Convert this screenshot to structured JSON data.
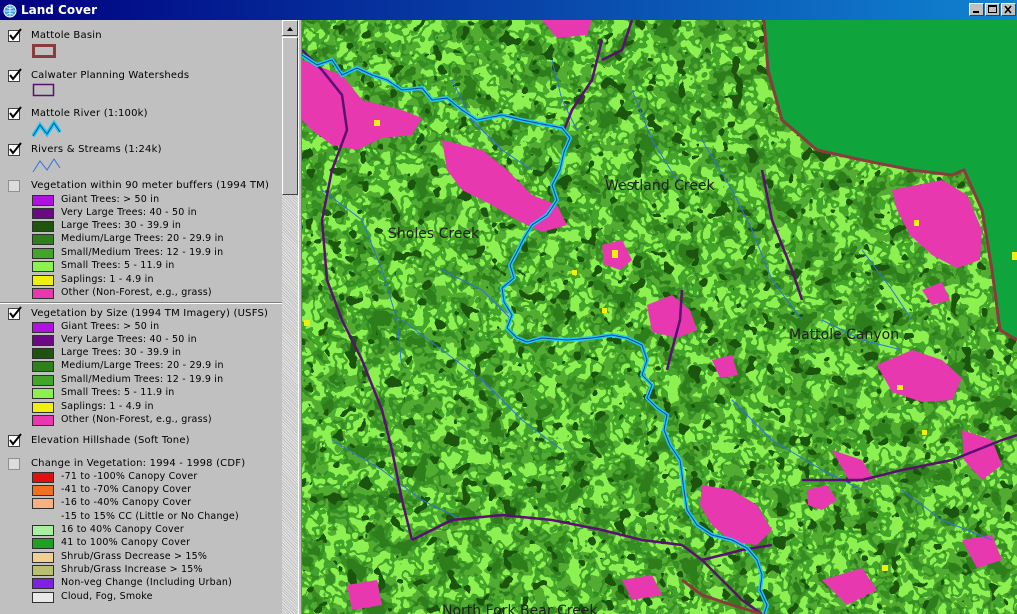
{
  "window": {
    "title": "Land Cover",
    "icon": "globe-icon",
    "controls": [
      "minimize-icon",
      "maximize-icon",
      "close-icon"
    ]
  },
  "toc": {
    "layers": [
      {
        "name": "Mattole Basin",
        "checked": true
      },
      {
        "name": "Calwater Planning Watersheds",
        "checked": true
      },
      {
        "name": "Mattole River (1:100k)",
        "checked": true
      },
      {
        "name": "Rivers & Streams (1:24k)",
        "checked": true
      },
      {
        "name": "Vegetation within 90 meter buffers (1994 TM)",
        "checked": false,
        "classes": [
          {
            "label": "Giant Trees: > 50 in",
            "color": "#b010e0"
          },
          {
            "label": "Very Large Trees: 40 - 50 in",
            "color": "#6a0a82"
          },
          {
            "label": "Large Trees: 30 - 39.9 in",
            "color": "#1f5410"
          },
          {
            "label": "Medium/Large Trees: 20 - 29.9 in",
            "color": "#2f7f1d"
          },
          {
            "label": "Small/Medium Trees: 12 - 19.9 in",
            "color": "#43a42a"
          },
          {
            "label": "Small Trees: 5 - 11.9 in",
            "color": "#8cf050"
          },
          {
            "label": "Saplings: 1 - 4.9 in",
            "color": "#f0f010"
          },
          {
            "label": "Other (Non-Forest, e.g., grass)",
            "color": "#e838b0"
          }
        ]
      },
      {
        "name": "Vegetation by Size (1994 TM Imagery) (USFS)",
        "checked": true,
        "classes": [
          {
            "label": "Giant Trees: > 50 in",
            "color": "#b010e0"
          },
          {
            "label": "Very Large Trees: 40 - 50 in",
            "color": "#6a0a82"
          },
          {
            "label": "Large Trees: 30 - 39.9 in",
            "color": "#1f5410"
          },
          {
            "label": "Medium/Large Trees: 20 - 29.9 in",
            "color": "#2f7f1d"
          },
          {
            "label": "Small/Medium Trees: 12 - 19.9 in",
            "color": "#43a42a"
          },
          {
            "label": "Small Trees: 5 - 11.9 in",
            "color": "#8cf050"
          },
          {
            "label": "Saplings: 1 - 4.9 in",
            "color": "#f0f010"
          },
          {
            "label": "Other (Non-Forest, e.g., grass)",
            "color": "#e838b0"
          }
        ]
      },
      {
        "name": "Elevation Hillshade (Soft Tone)",
        "checked": true
      },
      {
        "name": "Change in Vegetation: 1994 - 1998 (CDF)",
        "checked": false,
        "classes": [
          {
            "label": "-71 to -100% Canopy Cover",
            "color": "#e01010"
          },
          {
            "label": "-41 to -70% Canopy Cover",
            "color": "#f07020"
          },
          {
            "label": "-16 to -40% Canopy Cover",
            "color": "#f8b080"
          },
          {
            "label": "-15 to 15% CC (Little or No Change)",
            "color": "none"
          },
          {
            "label": "16 to 40% Canopy Cover",
            "color": "#a8f0a0"
          },
          {
            "label": "41 to 100% Canopy Cover",
            "color": "#20a020"
          },
          {
            "label": "Shrub/Grass Decrease > 15%",
            "color": "#f0d090"
          },
          {
            "label": "Shrub/Grass Increase > 15%",
            "color": "#b8c070"
          },
          {
            "label": "Non-veg Change (Including Urban)",
            "color": "#8020e0"
          },
          {
            "label": "Cloud, Fog, Smoke",
            "color": "#e8e8e8"
          }
        ]
      }
    ]
  },
  "map": {
    "labels": [
      "Westland Creek",
      "Sholes Creek",
      "Mattole Canyon",
      "North Fork Bear Creek"
    ],
    "colors": {
      "small_trees": "#8cf050",
      "small_medium": "#43a42a",
      "medium_large": "#2f7f1d",
      "large": "#1f5410",
      "ocean": "#10a43c",
      "non_forest": "#e838b0",
      "saplings": "#f0f010",
      "basin_boundary": "#8a3c3c",
      "watershed_boundary": "#5a1070",
      "river": "#20c8f0",
      "streams": "#3070e0"
    }
  }
}
